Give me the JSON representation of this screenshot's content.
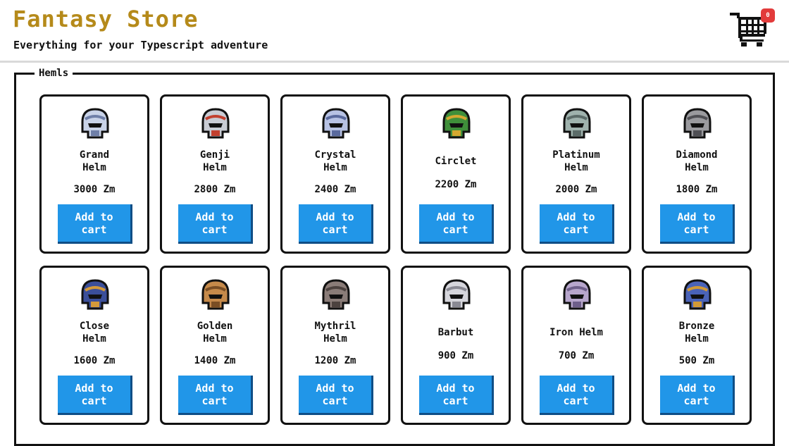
{
  "store": {
    "title": "Fantasy Store",
    "subtitle": "Everything for your Typescript adventure",
    "cart_badge": "0"
  },
  "section": {
    "title": "Hemls",
    "products": [
      {
        "name": [
          "Grand",
          "Helm"
        ],
        "price": "3000 Zm",
        "button": "Add to cart",
        "colors": [
          "#c9d3e8",
          "#6f7fa8"
        ]
      },
      {
        "name": [
          "Genji",
          "Helm"
        ],
        "price": "2800 Zm",
        "button": "Add to cart",
        "colors": [
          "#c9ccd4",
          "#c2402f"
        ]
      },
      {
        "name": [
          "Crystal",
          "Helm"
        ],
        "price": "2400 Zm",
        "button": "Add to cart",
        "colors": [
          "#b7c2e4",
          "#5a6a9e"
        ]
      },
      {
        "name": [
          "Circlet"
        ],
        "price": "2200 Zm",
        "button": "Add to cart",
        "colors": [
          "#3f8f3a",
          "#d4a830"
        ]
      },
      {
        "name": [
          "Platinum",
          "Helm"
        ],
        "price": "2000 Zm",
        "button": "Add to cart",
        "colors": [
          "#9fb2ad",
          "#5c6c69"
        ]
      },
      {
        "name": [
          "Diamond",
          "Helm"
        ],
        "price": "1800 Zm",
        "button": "Add to cart",
        "colors": [
          "#9a9a9e",
          "#4f4f54"
        ]
      },
      {
        "name": [
          "Close",
          "Helm"
        ],
        "price": "1600 Zm",
        "button": "Add to cart",
        "colors": [
          "#3b4f9a",
          "#d49a3a"
        ]
      },
      {
        "name": [
          "Golden",
          "Helm"
        ],
        "price": "1400 Zm",
        "button": "Add to cart",
        "colors": [
          "#c68a4a",
          "#7a4e24"
        ]
      },
      {
        "name": [
          "Mythril",
          "Helm"
        ],
        "price": "1200 Zm",
        "button": "Add to cart",
        "colors": [
          "#8a7c78",
          "#4c423f"
        ]
      },
      {
        "name": [
          "Barbut"
        ],
        "price": "900 Zm",
        "button": "Add to cart",
        "colors": [
          "#d6d6dc",
          "#8a8a94"
        ]
      },
      {
        "name": [
          "Iron Helm"
        ],
        "price": "700 Zm",
        "button": "Add to cart",
        "colors": [
          "#b7a6cc",
          "#6e5f8a"
        ]
      },
      {
        "name": [
          "Bronze",
          "Helm"
        ],
        "price": "500 Zm",
        "button": "Add to cart",
        "colors": [
          "#4a63b8",
          "#d29a36"
        ]
      }
    ]
  }
}
